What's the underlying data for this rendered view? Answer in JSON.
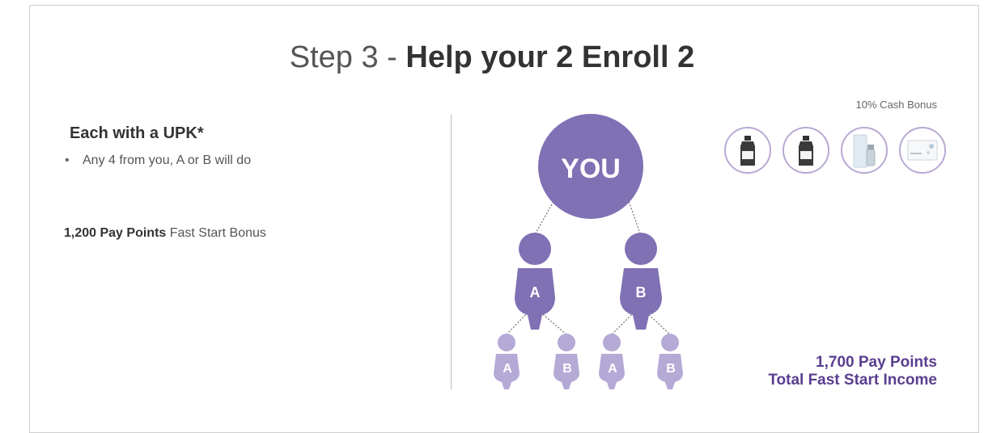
{
  "header": {
    "title_prefix": "Step 3 - ",
    "title_bold": "Help your 2 Enroll 2"
  },
  "left_panel": {
    "heading": "Each with a UPK*",
    "bullet": "Any 4 from you, A or B will do",
    "fast_start_bold": "1,200 Pay Points",
    "fast_start_rest": " Fast Start Bonus"
  },
  "right_panel": {
    "cash_bonus_label": "10% Cash Bonus",
    "products": [
      "bottle-product-icon",
      "bottle-product-icon",
      "tube-product-icon",
      "box-product-icon"
    ],
    "total_line1": "1,700 Pay Points",
    "total_line2": "Total Fast Start Income"
  },
  "tree": {
    "root": "YOU",
    "level1": [
      "A",
      "B"
    ],
    "level2": [
      "A",
      "B",
      "A",
      "B"
    ]
  },
  "colors": {
    "primary_purple": "#8070b4",
    "light_purple": "#b5a9d6",
    "accent_text": "#5a3e8f"
  }
}
